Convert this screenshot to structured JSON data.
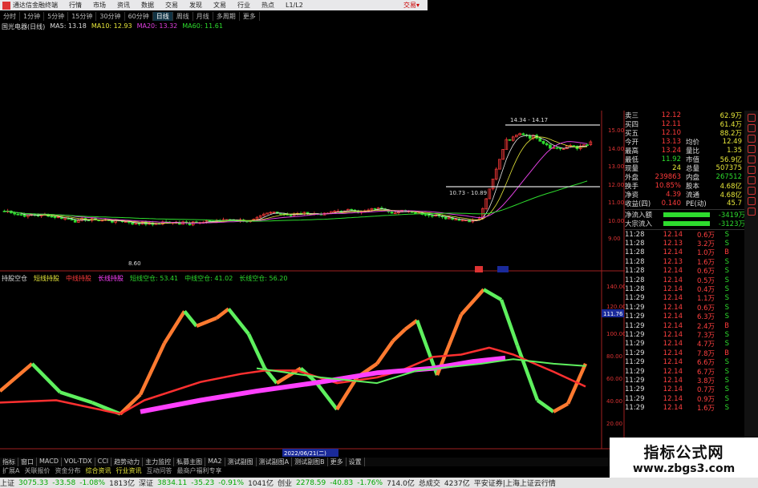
{
  "colors": {
    "up": "#ff3b3b",
    "down": "#2edc2e",
    "ma5": "#e6e6e6",
    "ma10": "#e8e83a",
    "ma20": "#e040e0",
    "ma60": "#2edc2e",
    "longline": "#ff40ff",
    "midline": "#ff3030",
    "short_up": "#ff7a30",
    "short_down": "#5ef05e"
  },
  "titlebar": {
    "app": "通达信金融终端",
    "menu": [
      "行情",
      "市场",
      "资讯",
      "数据",
      "交易",
      "发现",
      "文易",
      "行业",
      "热点",
      "L1/L2"
    ],
    "trade": "交易▾"
  },
  "periods": [
    "分时",
    "1分钟",
    "5分钟",
    "15分钟",
    "30分钟",
    "60分钟",
    "日线",
    "周线",
    "月线",
    "多周期",
    "更多"
  ],
  "active_period": "日线",
  "ma_legend": {
    "name": "国光电器(日线)",
    "ma5": "MA5: 13.18",
    "ma10": "MA10: 12.93",
    "ma20": "MA20: 13.32",
    "ma60": "MA60: 11.61"
  },
  "price_axis": [
    "15.00",
    "14.00",
    "13.00",
    "12.00",
    "11.00",
    "10.00",
    "9.00"
  ],
  "annotations": {
    "high": "14.34 - 14.17",
    "low_box": "10.73 - 10.89",
    "low_point": "8.60"
  },
  "ind_legend": {
    "name": "持股空仓",
    "items": [
      "短线持股",
      "中线持股",
      "长线持股",
      "短线空仓: 53.41",
      "中线空仓: 41.02",
      "长线空仓: 56.20"
    ]
  },
  "ind_axis": [
    "140.00",
    "120.00",
    "100.00",
    "80.00",
    "60.00",
    "40.00",
    "20.00"
  ],
  "ind_marker": "111.76",
  "date_label": "2022/06/21(二)",
  "quote": [
    {
      "k": "卖三",
      "v": "12.12",
      "k2": "",
      "v2": "62.9万"
    },
    {
      "k": "买四",
      "v": "12.11",
      "k2": "",
      "v2": "61.4万"
    },
    {
      "k": "买五",
      "v": "12.10",
      "k2": "",
      "v2": "88.2万"
    },
    {
      "k": "今开",
      "v": "13.13",
      "k2": "均价",
      "v2": "12.49"
    },
    {
      "k": "最高",
      "v": "13.24",
      "k2": "量比",
      "v2": "1.35"
    },
    {
      "k": "最低",
      "v": "11.92",
      "k2": "市值",
      "v2": "56.9亿"
    },
    {
      "k": "现量",
      "v": "24",
      "k2": "总量",
      "v2": "507375"
    },
    {
      "k": "外盘",
      "v": "239863",
      "k2": "内盘",
      "v2": "267512"
    },
    {
      "k": "换手",
      "v": "10.85%",
      "k2": "股本",
      "v2": "4.68亿"
    },
    {
      "k": "净资",
      "v": "4.39",
      "k2": "流通",
      "v2": "4.68亿"
    },
    {
      "k": "收益(四)",
      "v": "0.140",
      "k2": "PE(动)",
      "v2": "45.7"
    }
  ],
  "flows": [
    {
      "k": "净流入额",
      "v": "-3419万"
    },
    {
      "k": "大宗流入",
      "v": "-3123万"
    }
  ],
  "ticks": [
    [
      "11:28",
      "12.14",
      "0.6万",
      "S"
    ],
    [
      "11:28",
      "12.13",
      "3.2万",
      "S"
    ],
    [
      "11:28",
      "12.14",
      "1.0万",
      "B"
    ],
    [
      "11:28",
      "12.13",
      "1.6万",
      "S"
    ],
    [
      "11:28",
      "12.14",
      "0.6万",
      "S"
    ],
    [
      "11:28",
      "12.14",
      "0.5万",
      "S"
    ],
    [
      "11:28",
      "12.14",
      "0.4万",
      "S"
    ],
    [
      "11:29",
      "12.14",
      "1.1万",
      "S"
    ],
    [
      "11:29",
      "12.14",
      "0.6万",
      "S"
    ],
    [
      "11:29",
      "12.14",
      "6.3万",
      "S"
    ],
    [
      "11:29",
      "12.14",
      "2.4万",
      "B"
    ],
    [
      "11:29",
      "12.14",
      "7.3万",
      "S"
    ],
    [
      "11:29",
      "12.14",
      "4.7万",
      "S"
    ],
    [
      "11:29",
      "12.14",
      "7.8万",
      "B"
    ],
    [
      "11:29",
      "12.14",
      "6.6万",
      "S"
    ],
    [
      "11:29",
      "12.14",
      "6.7万",
      "S"
    ],
    [
      "11:29",
      "12.14",
      "3.8万",
      "S"
    ],
    [
      "11:29",
      "12.14",
      "0.7万",
      "S"
    ],
    [
      "11:29",
      "12.14",
      "0.9万",
      "S"
    ],
    [
      "11:29",
      "12.14",
      "1.6万",
      "S"
    ]
  ],
  "bottom_tabs": [
    "指标",
    "窗口",
    "MACD",
    "VOL-TDX",
    "CCI",
    "趋势动力",
    "主力监控",
    "私募主图",
    "MA2",
    "测试副图",
    "测试副图A",
    "测试副图B",
    "更多",
    "设置"
  ],
  "ind_tabs": [
    "扩展A",
    "关联报价",
    "资金分布",
    "综合资讯",
    "行业资讯",
    "互动问答",
    "最商户福利专享"
  ],
  "watermark": {
    "line1": "指标公式网",
    "line2": "www.zbgs3.com"
  },
  "status": {
    "sh_name": "上证",
    "sh_val": "3075.33",
    "sh_chg": "-33.58",
    "sh_pct": "-1.08%",
    "sh_amt": "1813亿",
    "sz_name": "深证",
    "sz_val": "3834.11",
    "sz_chg": "-35.23",
    "sz_pct": "-0.91%",
    "sz_amt": "1041亿",
    "cy_name": "创业",
    "cy_val": "2278.59",
    "cy_chg": "-40.83",
    "cy_pct": "-1.76%",
    "cy_amt": "714.0亿",
    "total_name": "总成交",
    "total_amt": "4237亿",
    "broker": "平安证券|上海上证云行情"
  }
}
